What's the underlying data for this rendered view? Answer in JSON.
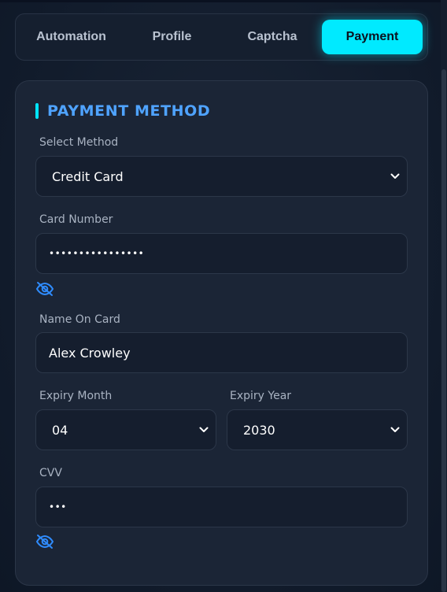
{
  "tabs": [
    {
      "label": "Automation",
      "active": false
    },
    {
      "label": "Profile",
      "active": false
    },
    {
      "label": "Captcha",
      "active": false
    },
    {
      "label": "Payment",
      "active": true
    }
  ],
  "colors": {
    "accent": "#00eaff",
    "title": "#4fa3ff",
    "eye_icon": "#2f8cff"
  },
  "payment": {
    "section_title": "PAYMENT METHOD",
    "select_method": {
      "label": "Select Method",
      "value": "Credit Card"
    },
    "card_number": {
      "label": "Card Number",
      "value": "••••••••••••••••"
    },
    "name_on_card": {
      "label": "Name On Card",
      "value": "Alex Crowley"
    },
    "expiry_month": {
      "label": "Expiry Month",
      "value": "04"
    },
    "expiry_year": {
      "label": "Expiry Year",
      "value": "2030"
    },
    "cvv": {
      "label": "CVV",
      "value": "•••"
    }
  },
  "icons": [
    "eye-slash-icon",
    "chevron-down-icon"
  ]
}
